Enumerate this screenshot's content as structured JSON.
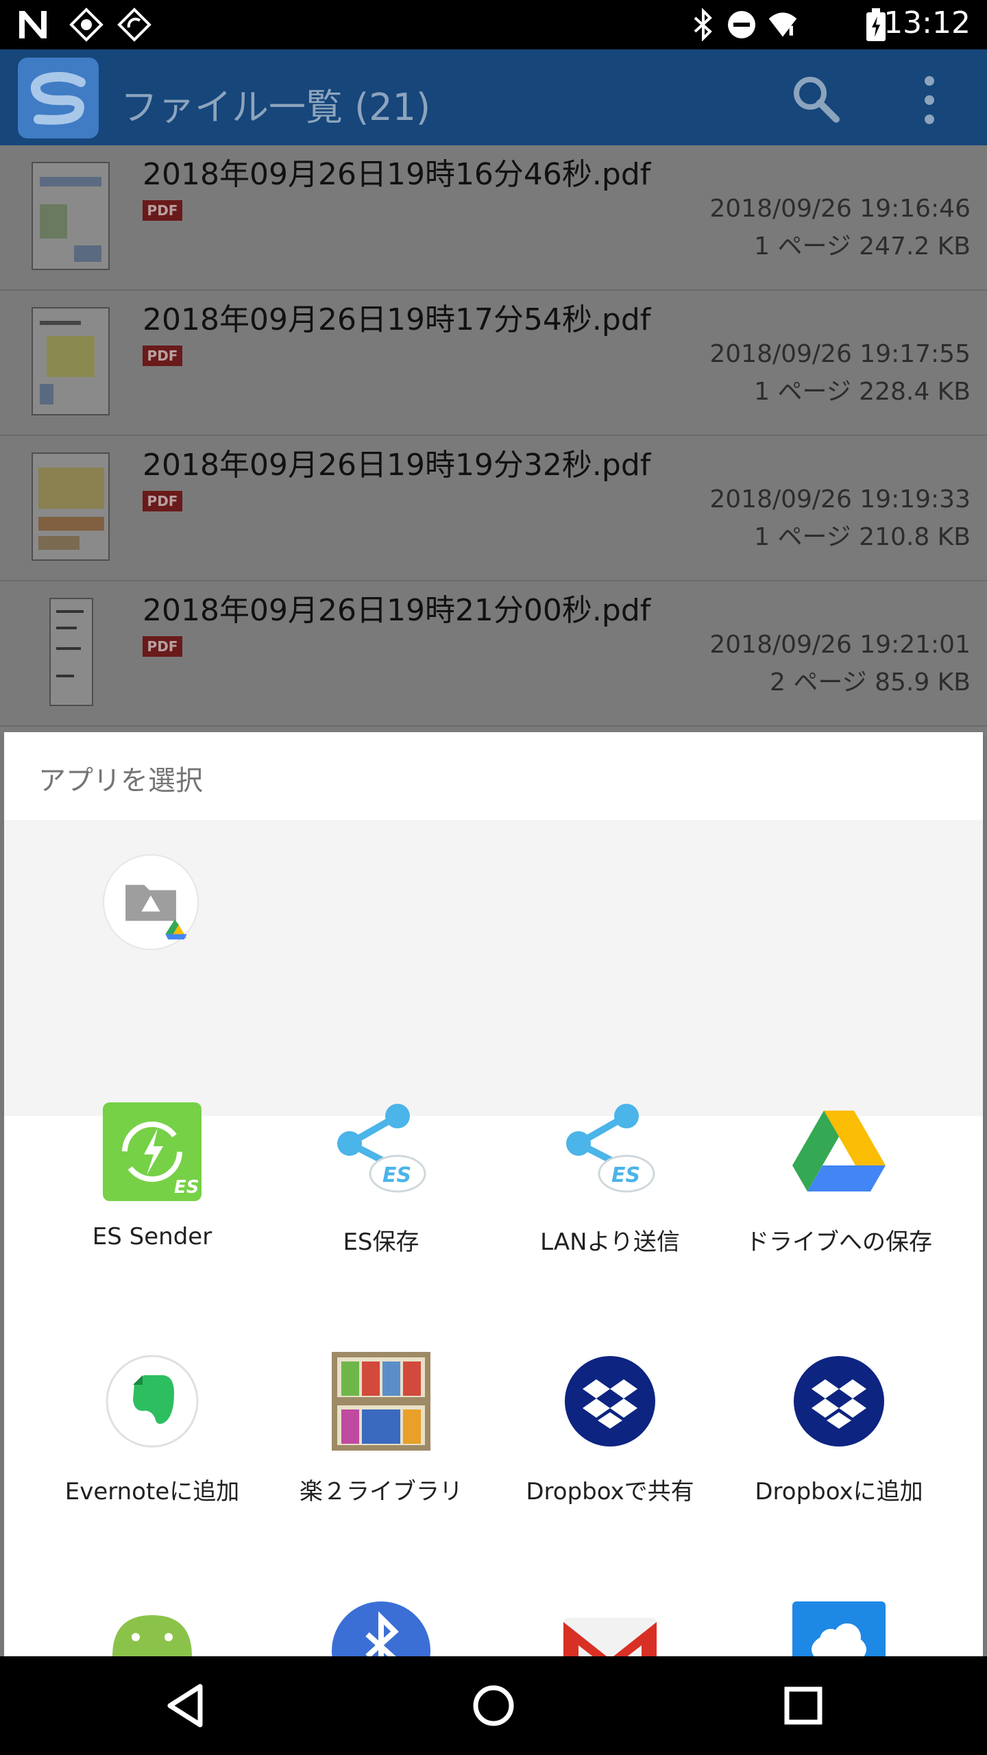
{
  "status_bar": {
    "time": "13:12",
    "notification_icons": [
      "n-letter-icon",
      "sound-wave-icon",
      "sync-badge-icon"
    ],
    "system_icons": [
      "bluetooth-icon",
      "do-not-disturb-icon",
      "wifi-icon",
      "battery-icon"
    ]
  },
  "app_bar": {
    "title": "ファイル一覧 (21)",
    "actions": [
      "search-icon",
      "more-vert-icon"
    ]
  },
  "files": [
    {
      "name": "2018年09月26日19時16分46秒.pdf",
      "badge": "PDF",
      "date": "2018/09/26 19:16:46",
      "meta": "1 ページ 247.2 KB"
    },
    {
      "name": "2018年09月26日19時17分54秒.pdf",
      "badge": "PDF",
      "date": "2018/09/26 19:17:55",
      "meta": "1 ページ 228.4 KB"
    },
    {
      "name": "2018年09月26日19時19分32秒.pdf",
      "badge": "PDF",
      "date": "2018/09/26 19:19:33",
      "meta": "1 ページ 210.8 KB"
    },
    {
      "name": "2018年09月26日19時21分00秒.pdf",
      "badge": "PDF",
      "date": "2018/09/26 19:21:01",
      "meta": "2 ページ 85.9 KB"
    }
  ],
  "chooser": {
    "title": "アプリを選択",
    "recent_target": "drive-folder-icon",
    "apps": [
      {
        "label": "ES Sender",
        "icon": "es-sender-icon"
      },
      {
        "label": "ES保存",
        "icon": "es-share-icon"
      },
      {
        "label": "LANより送信",
        "icon": "es-share-icon"
      },
      {
        "label": "ドライブへの保存",
        "icon": "google-drive-icon"
      },
      {
        "label": "Evernoteに追加",
        "icon": "evernote-icon"
      },
      {
        "label": "楽２ライブラリ",
        "icon": "bookshelf-icon"
      },
      {
        "label": "Dropboxで共有",
        "icon": "dropbox-icon"
      },
      {
        "label": "Dropboxに追加",
        "icon": "dropbox-icon"
      },
      {
        "label": "",
        "icon": "android-icon"
      },
      {
        "label": "",
        "icon": "bluetooth-app-icon"
      },
      {
        "label": "",
        "icon": "gmail-icon"
      },
      {
        "label": "",
        "icon": "cloud-app-icon"
      }
    ]
  },
  "nav_bar": {
    "buttons": [
      "back-icon",
      "home-icon",
      "recents-icon"
    ]
  },
  "colors": {
    "app_bar": "#16467a",
    "list_bg_dimmed": "#7a7a7a",
    "sheet_bg": "#ffffff",
    "recent_bg": "#f4f4f4",
    "dropbox": "#0d2481",
    "es_sender": "#76d146",
    "es_share": "#4bb4e8"
  }
}
